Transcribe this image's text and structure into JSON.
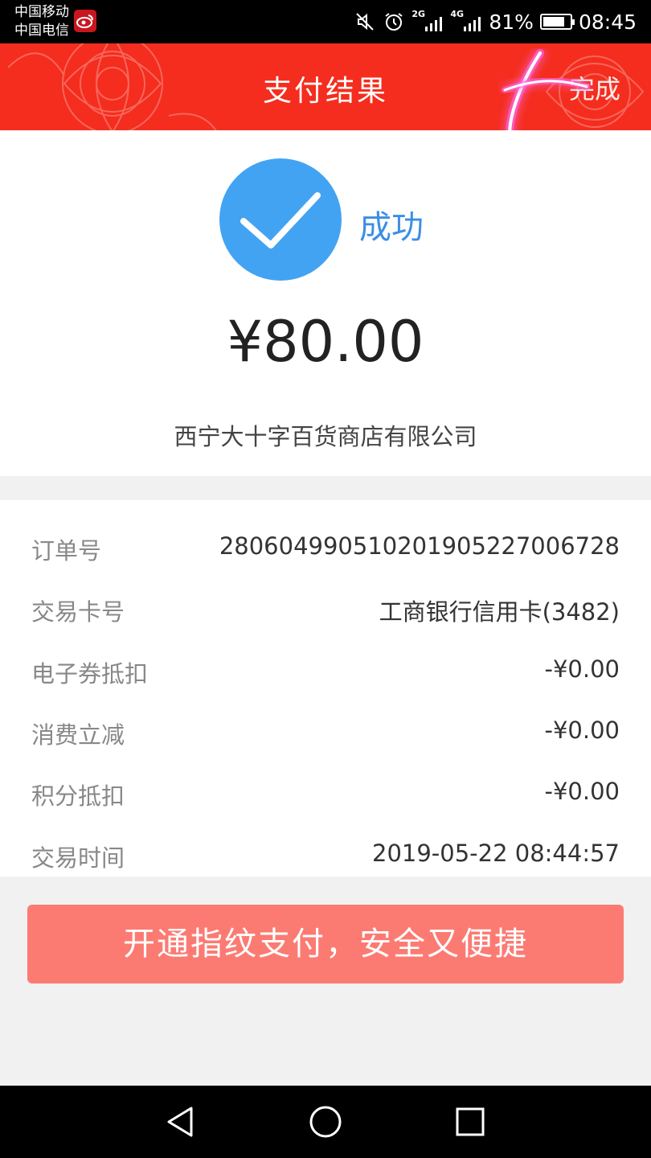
{
  "status_bar": {
    "carrier_1": "中国移动",
    "carrier_2": "中国电信",
    "net_1": "2G",
    "net_2": "4G",
    "battery": "81%",
    "time": "08:45",
    "icons": [
      "weibo-icon",
      "mute-icon",
      "alarm-icon",
      "signal-icon",
      "battery-icon"
    ]
  },
  "header": {
    "title": "支付结果",
    "done_label": "完成"
  },
  "result": {
    "status": "成功",
    "amount": "¥80.00",
    "merchant": "西宁大十字百货商店有限公司"
  },
  "details": [
    {
      "label": "订单号",
      "value": "28060499051020190522700672​8"
    },
    {
      "label": "交易卡号",
      "value": "工商银行信用卡(3482)"
    },
    {
      "label": "电子券抵扣",
      "value": "-¥0.00"
    },
    {
      "label": "消费立减",
      "value": "-¥0.00"
    },
    {
      "label": "积分抵扣",
      "value": "-¥0.00"
    },
    {
      "label": "交易时间",
      "value": "2019-05-22 08:44:57"
    }
  ],
  "fingerprint_button": "开通指纹支付，安全又便捷",
  "colors": {
    "header": "#f42d1e",
    "success": "#42a3f2",
    "button": "#fb7b73"
  }
}
